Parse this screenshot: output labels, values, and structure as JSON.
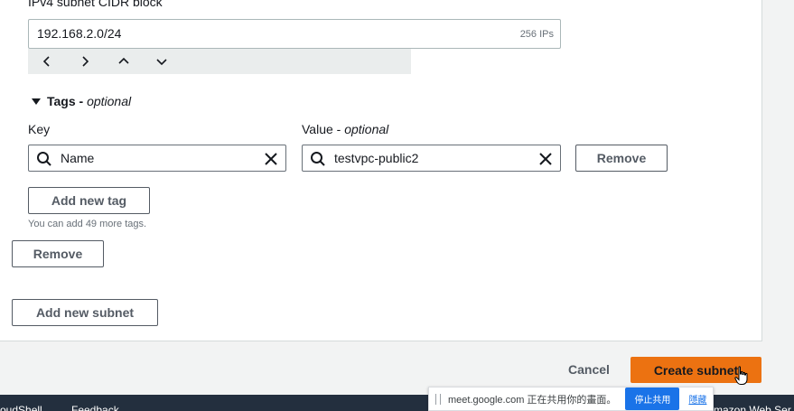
{
  "cidr": {
    "label": "IPv4 subnet CIDR block",
    "value": "192.168.2.0/24",
    "hint": "256 IPs"
  },
  "stepper": {
    "icons": [
      "chevron-left-icon",
      "chevron-right-icon",
      "chevron-up-icon",
      "chevron-down-icon"
    ]
  },
  "tags": {
    "toggle_label": "Tags - ",
    "toggle_optional": "optional",
    "key_label": "Key",
    "value_label": "Value - ",
    "value_optional": "optional",
    "key_value": "Name",
    "value_value": "testvpc-public2",
    "remove_tag_label": "Remove",
    "add_tag_label": "Add new tag",
    "hint": "You can add 49 more tags."
  },
  "subnet": {
    "remove_label": "Remove",
    "add_label": "Add new subnet"
  },
  "footer": {
    "cancel_label": "Cancel",
    "create_label": "Create subnet"
  },
  "bottom_bar": {
    "cloudshell": "oudShell",
    "feedback": "Feedback",
    "right_text": "mazon Web Ser"
  },
  "meet": {
    "message": "meet.google.com 正在共用你的畫面。",
    "stop_label": "停止共用",
    "hide_label": "隱藏"
  },
  "colors": {
    "primary": "#ec7211",
    "dark_bar": "#232f3e",
    "meet_blue": "#1a73e8"
  }
}
